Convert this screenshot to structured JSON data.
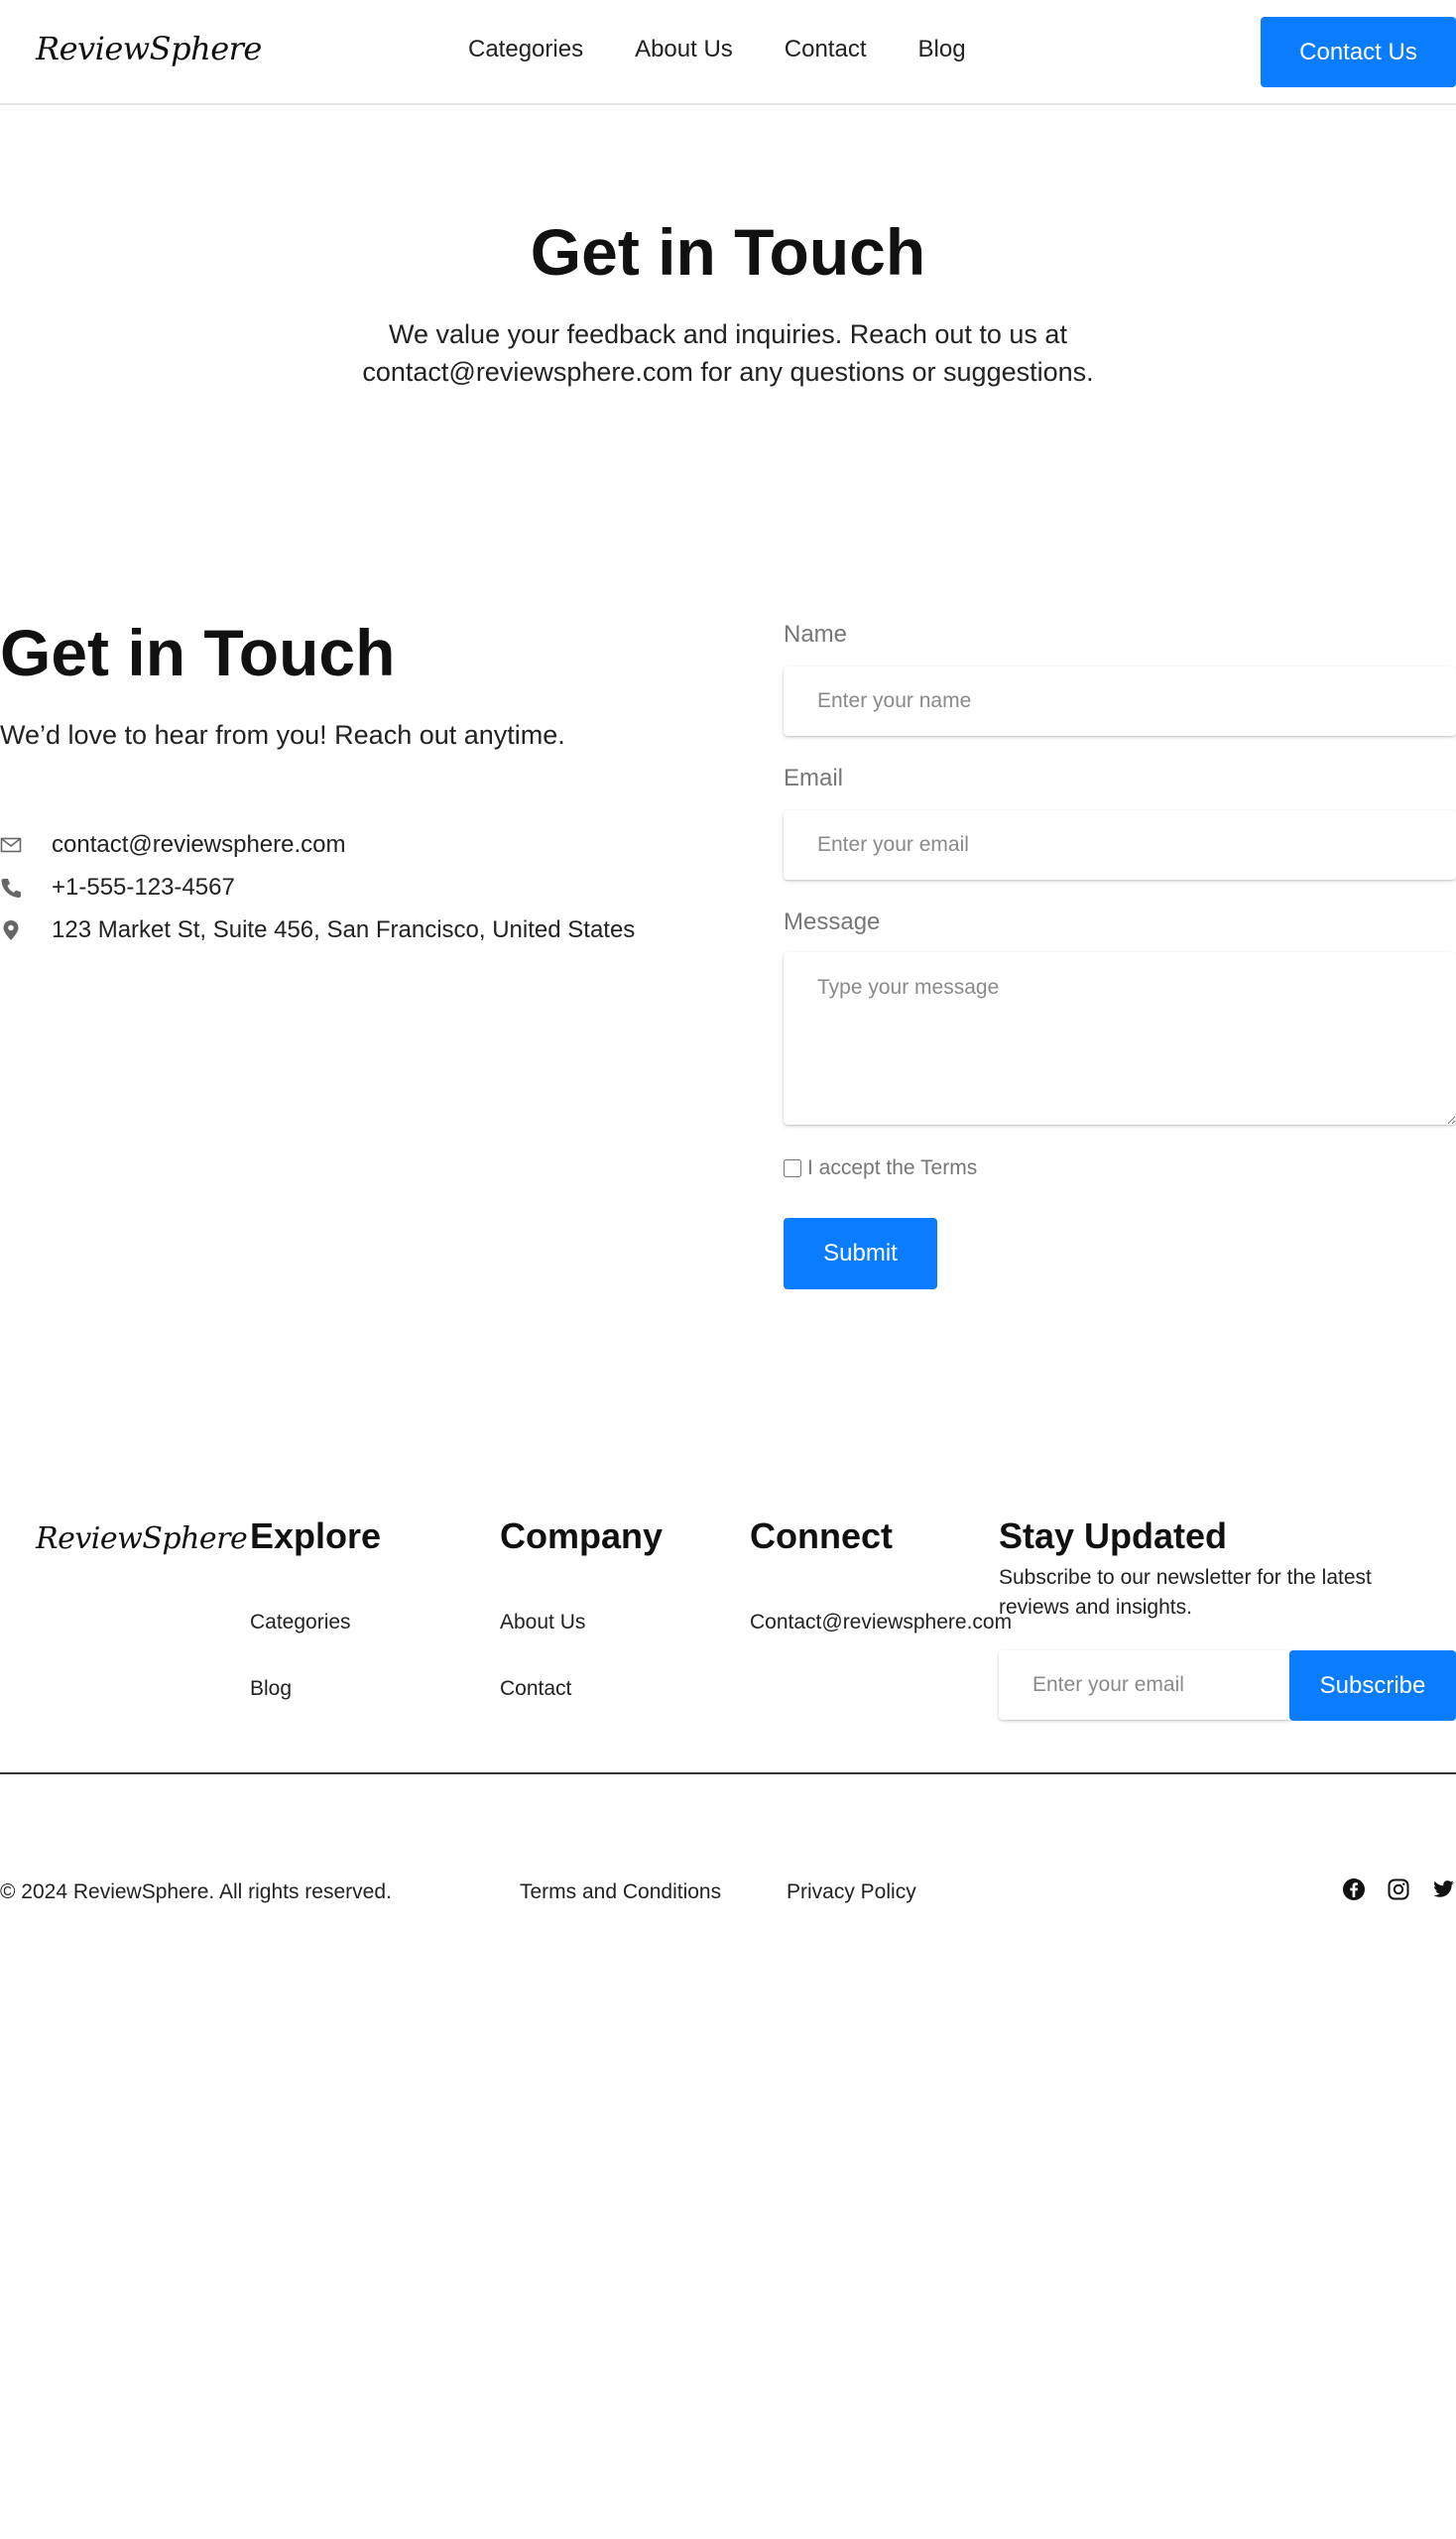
{
  "header": {
    "logo": "ReviewSphere",
    "nav": [
      "Categories",
      "About Us",
      "Contact",
      "Blog"
    ],
    "cta_label": "Contact Us"
  },
  "hero": {
    "title": "Get in Touch",
    "text": "We value your feedback and inquiries. Reach out to us at contact@reviewsphere.com for any questions or suggestions."
  },
  "contact": {
    "title": "Get in Touch",
    "subtitle": "We’d love to hear from you! Reach out anytime.",
    "email": "contact@reviewsphere.com",
    "phone": "+1-555-123-4567",
    "address": "123 Market St, Suite 456, San Francisco, United States",
    "icons": [
      "envelope-icon",
      "phone-icon",
      "map-pin-icon"
    ]
  },
  "form": {
    "name_label": "Name",
    "name_placeholder": "Enter your name",
    "email_label": "Email",
    "email_placeholder": "Enter your email",
    "message_label": "Message",
    "message_placeholder": "Type your message",
    "terms_label": "I accept the Terms",
    "terms_checked": false,
    "submit_label": "Submit"
  },
  "footer": {
    "logo": "ReviewSphere",
    "explore": {
      "heading": "Explore",
      "links": [
        "Categories",
        "Blog"
      ]
    },
    "company": {
      "heading": "Company",
      "links": [
        "About Us",
        "Contact"
      ]
    },
    "connect": {
      "heading": "Connect",
      "email": "Contact@reviewsphere.com"
    },
    "newsletter": {
      "heading": "Stay Updated",
      "text": "Subscribe to our newsletter for the latest reviews and insights.",
      "placeholder": "Enter your email",
      "button_label": "Subscribe"
    },
    "copyright": "© 2024 ReviewSphere. All rights reserved.",
    "legal": [
      "Terms and Conditions",
      "Privacy Policy"
    ],
    "social_icons": [
      "facebook-icon",
      "instagram-icon",
      "twitter-icon"
    ]
  },
  "colors": {
    "accent": "#0a7cff",
    "text": "#111111",
    "muted": "#777777",
    "background": "#ffffff"
  }
}
